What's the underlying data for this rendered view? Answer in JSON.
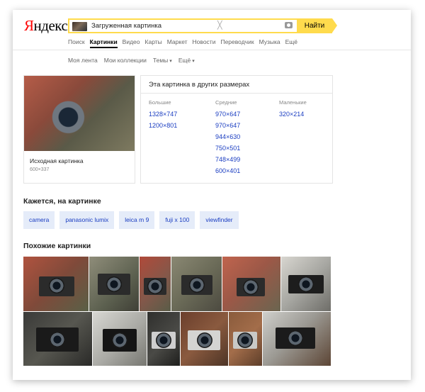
{
  "header": {
    "logo_first": "Я",
    "logo_rest": "ндекс",
    "search_query": "Загруженная картинка",
    "clear_symbol": "╳",
    "search_button": "Найти"
  },
  "tabs": [
    {
      "label": "Поиск",
      "active": false
    },
    {
      "label": "Картинки",
      "active": true
    },
    {
      "label": "Видео",
      "active": false
    },
    {
      "label": "Карты",
      "active": false
    },
    {
      "label": "Маркет",
      "active": false
    },
    {
      "label": "Новости",
      "active": false
    },
    {
      "label": "Переводчик",
      "active": false
    },
    {
      "label": "Музыка",
      "active": false
    },
    {
      "label": "Ещё",
      "active": false
    }
  ],
  "subnav": {
    "feed": "Моя лента",
    "collections": "Мои коллекции",
    "themes": "Темы",
    "more": "Ещё",
    "caret": "▾"
  },
  "source": {
    "title": "Исходная картинка",
    "size": "600×337"
  },
  "sizes": {
    "title": "Эта картинка в других размерах",
    "large": {
      "label": "Большие",
      "items": [
        "1328×747",
        "1200×801"
      ]
    },
    "medium": {
      "label": "Средние",
      "items": [
        "970×647",
        "970×647",
        "944×630",
        "750×501",
        "748×499",
        "600×401"
      ]
    },
    "small": {
      "label": "Маленькие",
      "items": [
        "320×214"
      ]
    }
  },
  "tags_section": {
    "title": "Кажется, на картинке",
    "tags": [
      "camera",
      "panasonic lumix",
      "leica m 9",
      "fuji x 100",
      "viewfinder"
    ]
  },
  "similar_section": {
    "title": "Похожие картинки"
  },
  "colors": {
    "accent": "#ffdb4d",
    "link": "#1a3dc1",
    "tag_bg": "#e5ecf9",
    "logo_red": "#ff0000"
  }
}
